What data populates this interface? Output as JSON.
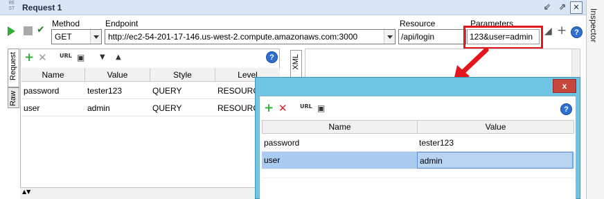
{
  "window": {
    "icon_text": "RE ST",
    "title": "Request 1"
  },
  "inspector": {
    "label": "Inspector"
  },
  "toolbar": {
    "method_label": "Method",
    "method_value": "GET",
    "endpoint_label": "Endpoint",
    "endpoint_value": "http://ec2-54-201-17-146.us-west-2.compute.amazonaws.com:3000",
    "resource_label": "Resource",
    "resource_value": "/api/login",
    "parameters_label": "Parameters",
    "parameters_value": "123&user=admin"
  },
  "tabs": {
    "request": "Request",
    "raw": "Raw",
    "xml": "XML"
  },
  "request_grid": {
    "columns": [
      "Name",
      "Value",
      "Style",
      "Level"
    ],
    "rows": [
      [
        "password",
        "tester123",
        "QUERY",
        "RESOURCE"
      ],
      [
        "user",
        "admin",
        "QUERY",
        "RESOURCE"
      ]
    ],
    "split_label": "▲▼"
  },
  "dialog": {
    "close_label": "x",
    "columns": [
      "Name",
      "Value"
    ],
    "rows": [
      [
        "password",
        "tester123"
      ],
      [
        "user",
        "admin"
      ]
    ]
  },
  "colors": {
    "highlight": "#e3171b",
    "dialog_frame": "#6fc6e4",
    "selected_row": "#a9ccf0"
  }
}
